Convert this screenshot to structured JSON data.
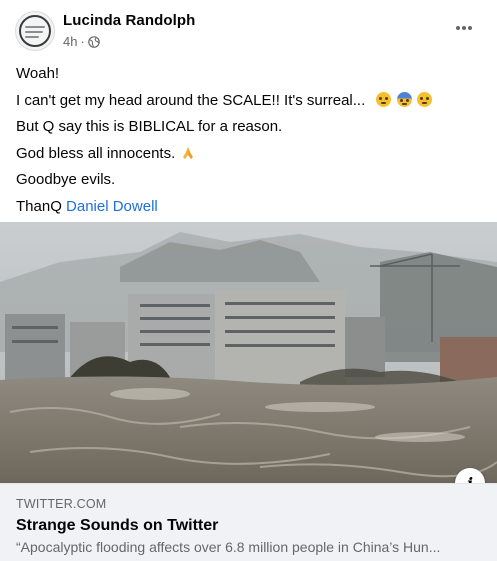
{
  "post": {
    "author": "Lucinda Randolph",
    "time": "4h",
    "separator": "·",
    "privacy_icon": "globe-icon",
    "more_icon": "more-options-icon",
    "lines": {
      "l1": "Woah!",
      "l2": "I can't get my head around the SCALE!! It's surreal...",
      "l3": "But Q say this is BIBLICAL for a reason.",
      "l4": "God bless all innocents.",
      "l5": "Goodbye evils.",
      "l6_prefix": "ThanQ",
      "l6_link": "Daniel Dowell"
    },
    "emojis": [
      "flushed-face-icon",
      "fearful-face-icon",
      "flushed-face-icon",
      "folded-hands-icon"
    ]
  },
  "link_preview": {
    "domain": "TWITTER.COM",
    "title": "Strange Sounds on Twitter",
    "description": "“Apocalyptic flooding affects over 6.8 million people in China’s Hun...",
    "info_label": "i"
  },
  "colors": {
    "link": "#216fdb",
    "secondary_text": "#65676b",
    "preview_bg": "#f0f2f5"
  }
}
